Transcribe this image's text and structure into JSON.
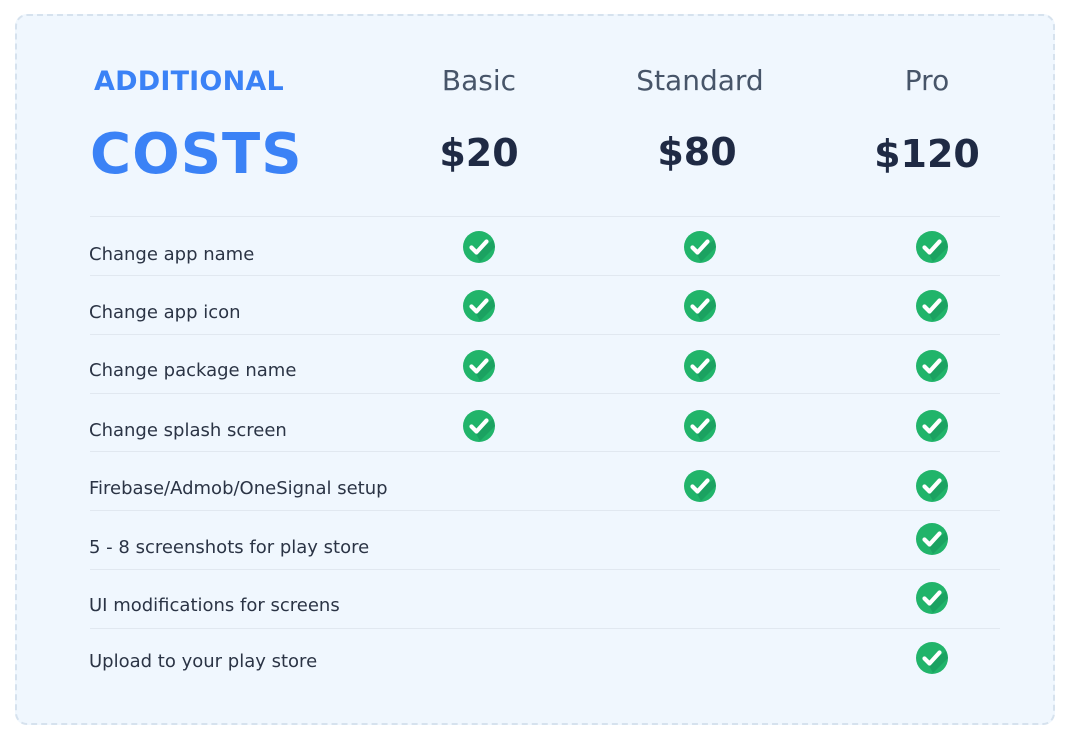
{
  "heading": {
    "line1": "ADDITIONAL",
    "line2": "COSTS"
  },
  "plans": [
    {
      "name": "Basic",
      "price": "$20"
    },
    {
      "name": "Standard",
      "price": "$80"
    },
    {
      "name": "Pro",
      "price": "$120"
    }
  ],
  "features": [
    {
      "label": "Change app name",
      "included": [
        true,
        true,
        true
      ]
    },
    {
      "label": "Change app icon",
      "included": [
        true,
        true,
        true
      ]
    },
    {
      "label": "Change package name",
      "included": [
        true,
        true,
        true
      ]
    },
    {
      "label": "Change splash screen",
      "included": [
        true,
        true,
        true
      ]
    },
    {
      "label": "Firebase/Admob/OneSignal setup",
      "included": [
        false,
        true,
        true
      ]
    },
    {
      "label": "5 - 8 screenshots for play store",
      "included": [
        false,
        false,
        true
      ]
    },
    {
      "label": "UI modifications for screens",
      "included": [
        false,
        false,
        true
      ]
    },
    {
      "label": "Upload to your play store",
      "included": [
        false,
        false,
        true
      ]
    }
  ],
  "icons": {
    "included": "check-circle-icon"
  },
  "colors": {
    "accent": "#3b82f6",
    "check_green": "#21b46a",
    "check_shadow": "#17945a",
    "card_background": "#f0f7fe",
    "price_text": "#1f2a44",
    "plan_text": "#475569"
  }
}
